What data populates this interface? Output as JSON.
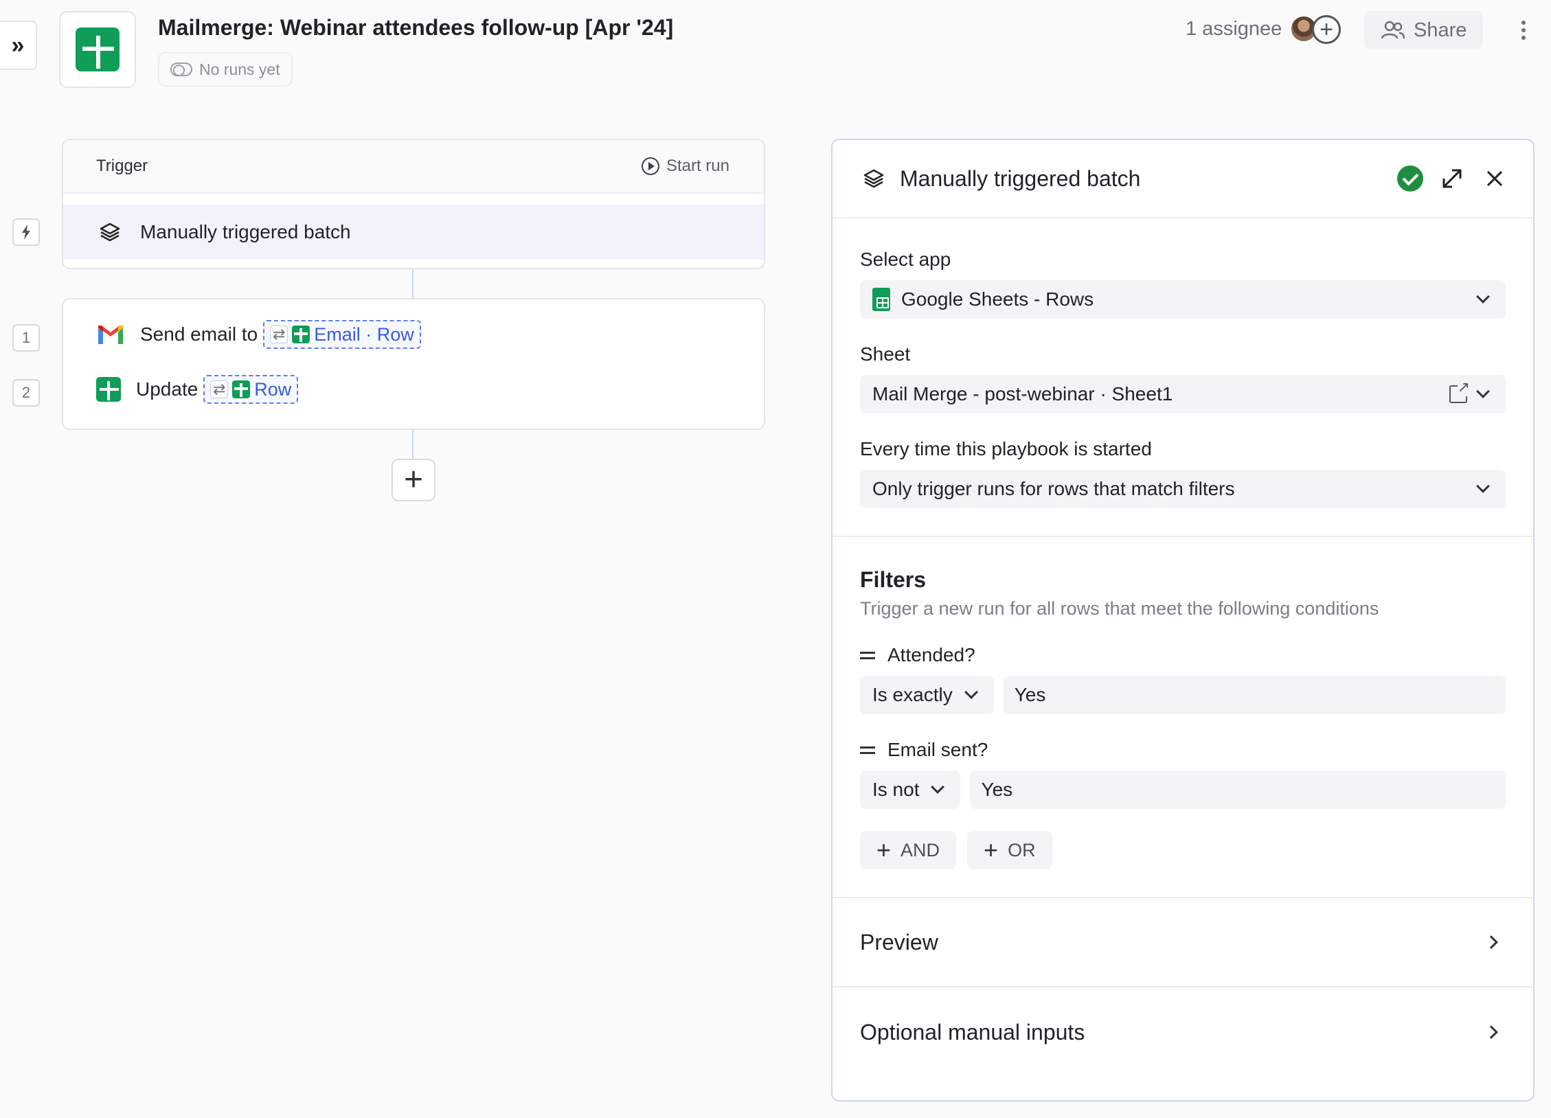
{
  "header": {
    "title": "Mailmerge: Webinar attendees follow-up [Apr '24]",
    "runs_status": "No runs yet",
    "assignee_label": "1 assignee",
    "share_label": "Share"
  },
  "canvas": {
    "trigger_header": "Trigger",
    "start_run_label": "Start run",
    "trigger_label": "Manually triggered batch",
    "steps": [
      {
        "number": "1",
        "text": "Send email to",
        "chip": "Email · Row"
      },
      {
        "number": "2",
        "text": "Update",
        "chip": "Row"
      }
    ]
  },
  "panel": {
    "title": "Manually triggered batch",
    "select_app_label": "Select app",
    "select_app_value": "Google Sheets - Rows",
    "sheet_label": "Sheet",
    "sheet_value": "Mail Merge - post-webinar · Sheet1",
    "start_label": "Every time this playbook is started",
    "start_value": "Only trigger runs for rows that match filters",
    "filters_title": "Filters",
    "filters_subtitle": "Trigger a new run for all rows that meet the following conditions",
    "conditions": [
      {
        "field": "Attended?",
        "operator": "Is exactly",
        "value": "Yes"
      },
      {
        "field": "Email sent?",
        "operator": "Is not",
        "value": "Yes"
      }
    ],
    "and_label": "AND",
    "or_label": "OR",
    "preview_label": "Preview",
    "optional_label": "Optional manual inputs"
  },
  "colors": {
    "sheets_green": "#0f9d58",
    "chip_blue": "#3b5bdb",
    "check_green": "#1e8e3e",
    "panel_border": "#cdd6f4"
  },
  "icons": [
    "expand-sidebar-icon",
    "google-sheets-icon",
    "toggle-icon",
    "add-assignee-icon",
    "people-icon",
    "more-icon",
    "play-icon",
    "layers-icon",
    "lightning-icon",
    "gmail-icon",
    "loop-icon",
    "plus-icon",
    "check-icon",
    "maximize-icon",
    "close-icon",
    "external-link-icon",
    "chevron-down-icon",
    "chevron-right-icon",
    "equals-icon"
  ]
}
